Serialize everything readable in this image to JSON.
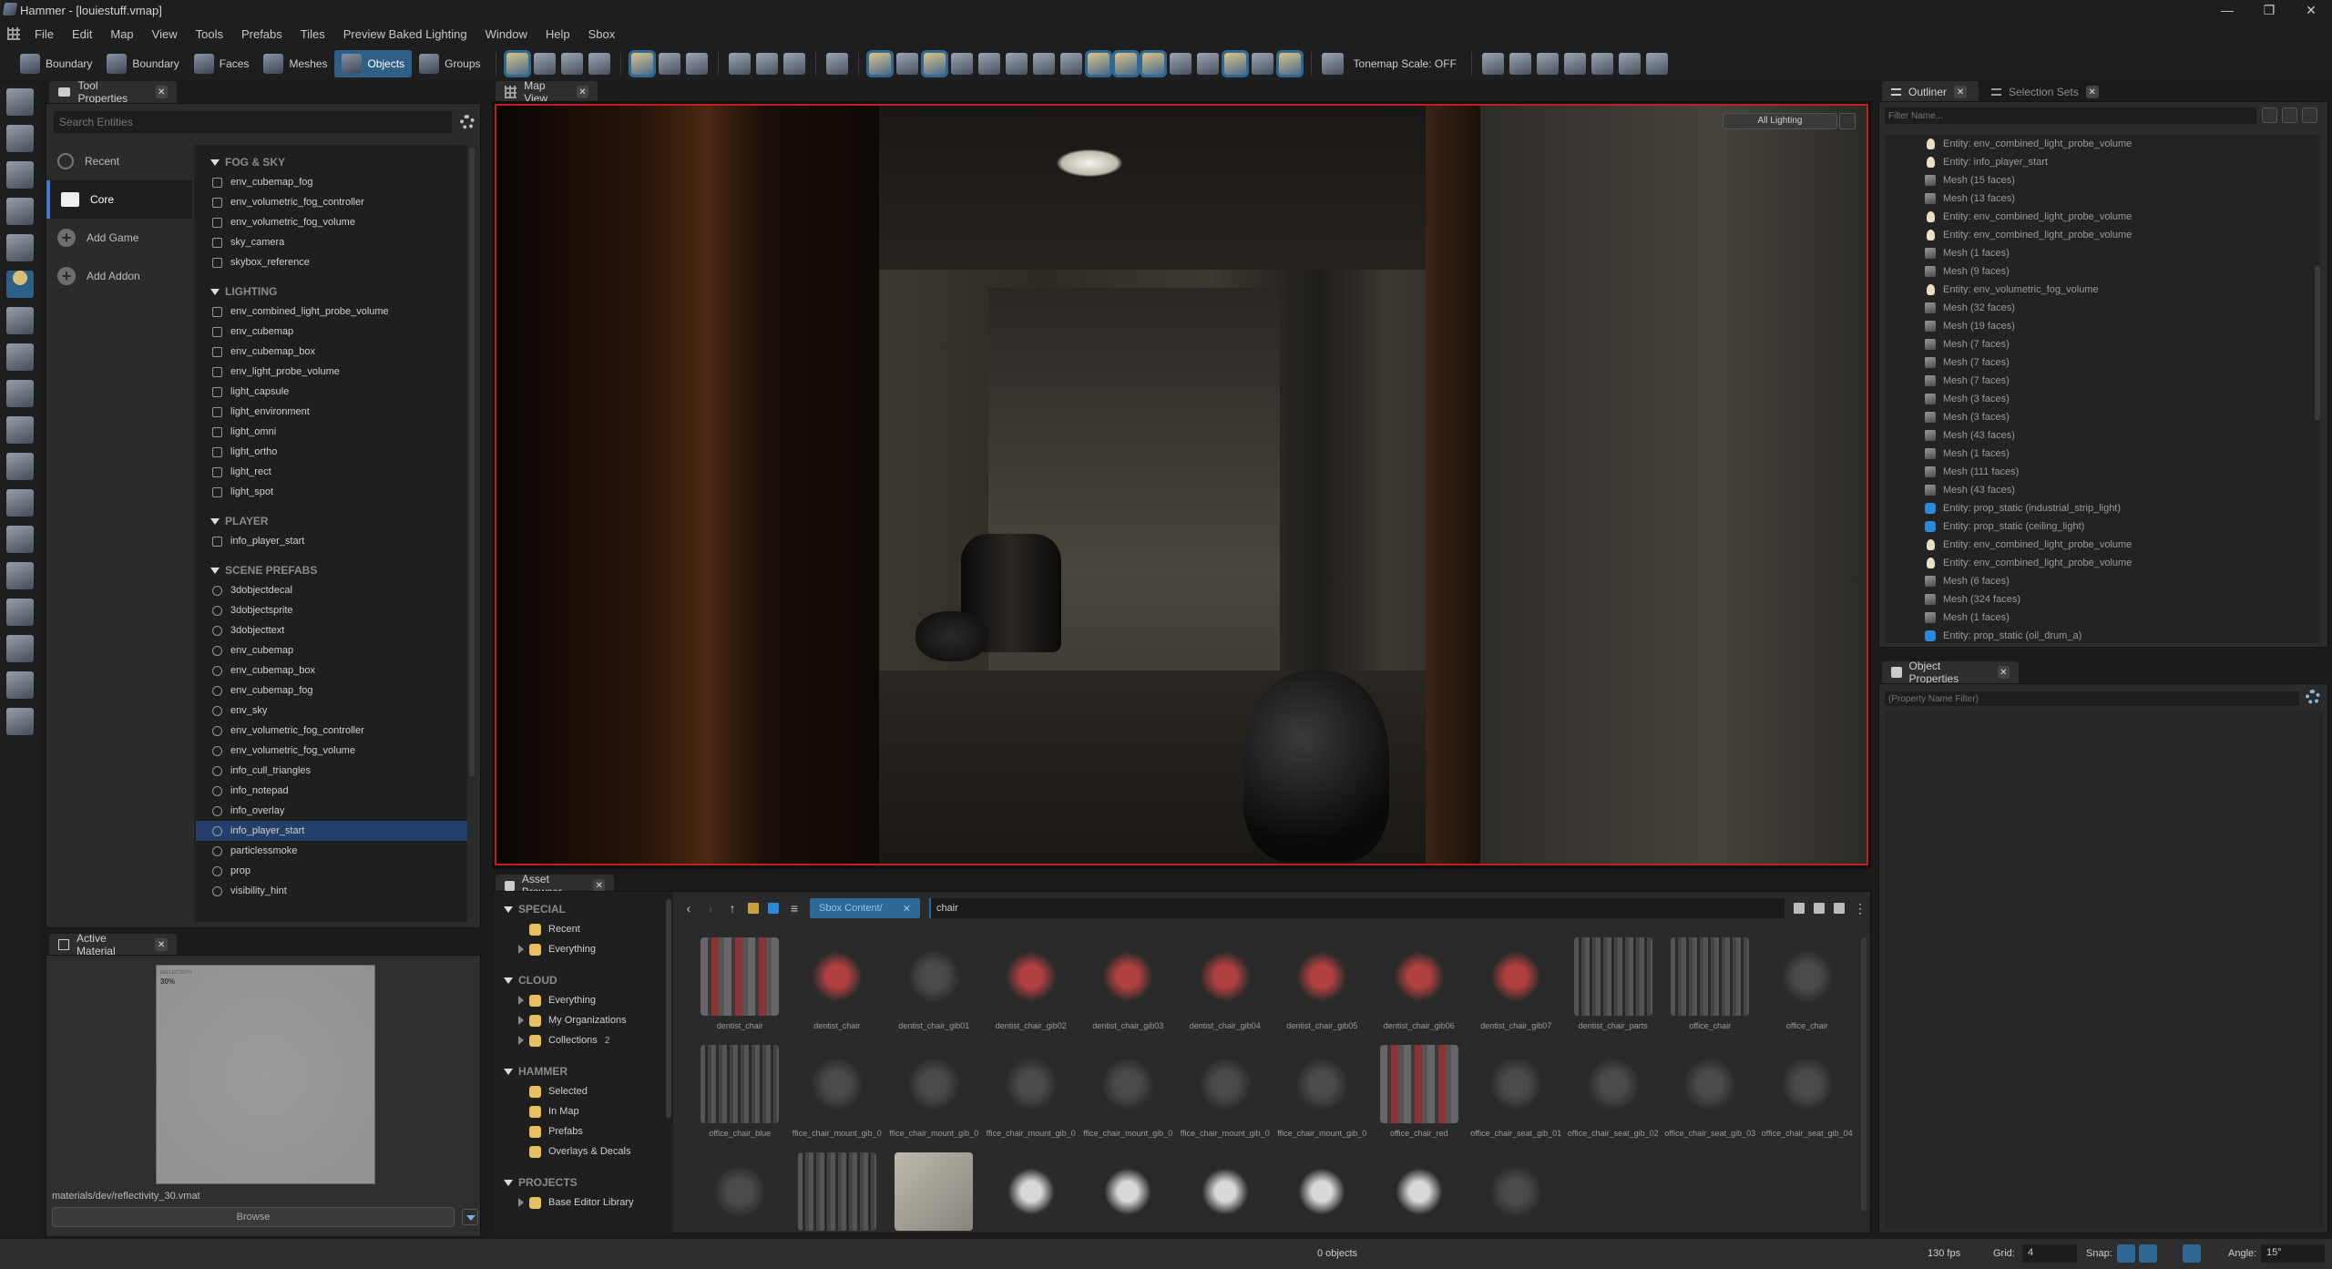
{
  "window": {
    "title": "Hammer - [louiestuff.vmap]",
    "controls": [
      "minimize",
      "restore",
      "close"
    ]
  },
  "menu": [
    "File",
    "Edit",
    "Map",
    "View",
    "Tools",
    "Prefabs",
    "Tiles",
    "Preview Baked Lighting",
    "Window",
    "Help",
    "Sbox"
  ],
  "toolbar": {
    "modes": [
      {
        "label": "Boundary",
        "icon": "boundary-icon",
        "active": false
      },
      {
        "label": "Boundary",
        "icon": "boundary-solid-icon",
        "active": false
      },
      {
        "label": "Faces",
        "icon": "faces-icon",
        "active": false
      },
      {
        "label": "Meshes",
        "icon": "meshes-icon",
        "active": false
      },
      {
        "label": "Objects",
        "icon": "objects-icon",
        "active": true
      },
      {
        "label": "Groups",
        "icon": "groups-icon",
        "active": false
      }
    ],
    "tonemap_label": "Tonemap Scale: OFF"
  },
  "tool_properties": {
    "tab": "Tool Properties",
    "search_placeholder": "Search Entities",
    "categories": [
      {
        "label": "Recent",
        "icon": "history-icon",
        "selected": false
      },
      {
        "label": "Core",
        "icon": "folder-icon",
        "selected": true
      },
      {
        "label": "Add Game",
        "icon": "plus-circle-icon",
        "selected": false
      },
      {
        "label": "Add Addon",
        "icon": "plus-circle-icon",
        "selected": false
      }
    ],
    "sections": [
      {
        "title": "FOG & SKY",
        "items": [
          "env_cubemap_fog",
          "env_volumetric_fog_controller",
          "env_volumetric_fog_volume",
          "sky_camera",
          "skybox_reference"
        ]
      },
      {
        "title": "LIGHTING",
        "items": [
          "env_combined_light_probe_volume",
          "env_cubemap",
          "env_cubemap_box",
          "env_light_probe_volume",
          "light_capsule",
          "light_environment",
          "light_omni",
          "light_ortho",
          "light_rect",
          "light_spot"
        ]
      },
      {
        "title": "PLAYER",
        "items": [
          "info_player_start"
        ]
      },
      {
        "title": "SCENE PREFABS",
        "items": [
          "3dobjectdecal",
          "3dobjectsprite",
          "3dobjecttext",
          "env_cubemap",
          "env_cubemap_box",
          "env_cubemap_fog",
          "env_sky",
          "env_volumetric_fog_controller",
          "env_volumetric_fog_volume",
          "info_cull_triangles",
          "info_notepad",
          "info_overlay",
          "info_player_start",
          "particlessmoke",
          "prop",
          "visibility_hint"
        ]
      }
    ],
    "selected_item": "info_player_start"
  },
  "active_material": {
    "tab": "Active Material",
    "preview_label": "REFLECTIVITY",
    "preview_value": "30%",
    "path": "materials/dev/reflectivity_30.vmat",
    "browse_label": "Browse"
  },
  "map_view": {
    "tab": "Map View",
    "lighting_mode": "All Lighting",
    "border_color": "#c21f1f"
  },
  "asset_browser": {
    "tab": "Asset Browser",
    "tree": [
      {
        "title": "SPECIAL",
        "items": [
          {
            "label": "Recent",
            "expandable": false
          },
          {
            "label": "Everything",
            "expandable": true
          }
        ]
      },
      {
        "title": "CLOUD",
        "items": [
          {
            "label": "Everything",
            "expandable": true
          },
          {
            "label": "My Organizations",
            "expandable": true
          },
          {
            "label": "Collections",
            "expandable": true,
            "count": "2"
          }
        ]
      },
      {
        "title": "HAMMER",
        "items": [
          {
            "label": "Selected",
            "expandable": false
          },
          {
            "label": "In Map",
            "expandable": false
          },
          {
            "label": "Prefabs",
            "expandable": false
          },
          {
            "label": "Overlays & Decals",
            "expandable": false
          }
        ]
      },
      {
        "title": "PROJECTS",
        "items": [
          {
            "label": "Base Editor Library",
            "expandable": true
          }
        ]
      }
    ],
    "path_crumb": "Sbox Content/",
    "search_value": "chair",
    "assets": [
      {
        "name": "dentist_chair",
        "thumb": "tex"
      },
      {
        "name": "dentist_chair",
        "thumb": "red"
      },
      {
        "name": "dentist_chair_gib01",
        "thumb": "grey"
      },
      {
        "name": "dentist_chair_gib02",
        "thumb": "red"
      },
      {
        "name": "dentist_chair_gib03",
        "thumb": "red"
      },
      {
        "name": "dentist_chair_gib04",
        "thumb": "red"
      },
      {
        "name": "dentist_chair_gib05",
        "thumb": "red"
      },
      {
        "name": "dentist_chair_gib06",
        "thumb": "red"
      },
      {
        "name": "dentist_chair_gib07",
        "thumb": "red"
      },
      {
        "name": "dentist_chair_parts",
        "thumb": "texd"
      },
      {
        "name": "office_chair",
        "thumb": "texd"
      },
      {
        "name": "office_chair",
        "thumb": "grey"
      },
      {
        "name": "office_chair_blue",
        "thumb": "texd"
      },
      {
        "name": "ffice_chair_mount_gib_0",
        "thumb": "grey"
      },
      {
        "name": "ffice_chair_mount_gib_0",
        "thumb": "grey"
      },
      {
        "name": "ffice_chair_mount_gib_0",
        "thumb": "grey"
      },
      {
        "name": "ffice_chair_mount_gib_0",
        "thumb": "grey"
      },
      {
        "name": "ffice_chair_mount_gib_0",
        "thumb": "grey"
      },
      {
        "name": "ffice_chair_mount_gib_0",
        "thumb": "grey"
      },
      {
        "name": "office_chair_red",
        "thumb": "tex"
      },
      {
        "name": "office_chair_seat_gib_01",
        "thumb": "grey"
      },
      {
        "name": "office_chair_seat_gib_02",
        "thumb": "grey"
      },
      {
        "name": "office_chair_seat_gib_03",
        "thumb": "grey"
      },
      {
        "name": "office_chair_seat_gib_04",
        "thumb": "grey"
      },
      {
        "name": "",
        "thumb": "grey"
      },
      {
        "name": "",
        "thumb": "texd"
      },
      {
        "name": "",
        "thumb": "concrete"
      },
      {
        "name": "",
        "thumb": "light"
      },
      {
        "name": "",
        "thumb": "light"
      },
      {
        "name": "",
        "thumb": "light"
      },
      {
        "name": "",
        "thumb": "light"
      },
      {
        "name": "",
        "thumb": "light"
      },
      {
        "name": "",
        "thumb": "grey"
      }
    ]
  },
  "outliner": {
    "tabs": [
      "Outliner",
      "Selection Sets"
    ],
    "filter_placeholder": "Filter Name...",
    "rows": [
      {
        "type": "ent",
        "label": "Entity: env_combined_light_probe_volume"
      },
      {
        "type": "ent",
        "label": "Entity: info_player_start"
      },
      {
        "type": "mesh",
        "label": "Mesh (15 faces)"
      },
      {
        "type": "mesh",
        "label": "Mesh (13 faces)"
      },
      {
        "type": "ent",
        "label": "Entity: env_combined_light_probe_volume"
      },
      {
        "type": "ent",
        "label": "Entity: env_combined_light_probe_volume"
      },
      {
        "type": "mesh",
        "label": "Mesh (1 faces)"
      },
      {
        "type": "mesh",
        "label": "Mesh (9 faces)"
      },
      {
        "type": "ent",
        "label": "Entity: env_volumetric_fog_volume"
      },
      {
        "type": "mesh",
        "label": "Mesh (32 faces)"
      },
      {
        "type": "mesh",
        "label": "Mesh (19 faces)"
      },
      {
        "type": "mesh",
        "label": "Mesh (7 faces)"
      },
      {
        "type": "mesh",
        "label": "Mesh (7 faces)"
      },
      {
        "type": "mesh",
        "label": "Mesh (7 faces)"
      },
      {
        "type": "mesh",
        "label": "Mesh (3 faces)"
      },
      {
        "type": "mesh",
        "label": "Mesh (3 faces)"
      },
      {
        "type": "mesh",
        "label": "Mesh (43 faces)"
      },
      {
        "type": "mesh",
        "label": "Mesh (1 faces)"
      },
      {
        "type": "mesh",
        "label": "Mesh (111 faces)"
      },
      {
        "type": "mesh",
        "label": "Mesh (43 faces)"
      },
      {
        "type": "prop",
        "label": "Entity: prop_static (industrial_strip_light)"
      },
      {
        "type": "prop",
        "label": "Entity: prop_static (ceiling_light)"
      },
      {
        "type": "ent",
        "label": "Entity: env_combined_light_probe_volume"
      },
      {
        "type": "ent",
        "label": "Entity: env_combined_light_probe_volume"
      },
      {
        "type": "mesh",
        "label": "Mesh (6 faces)"
      },
      {
        "type": "mesh",
        "label": "Mesh (324 faces)"
      },
      {
        "type": "mesh",
        "label": "Mesh (1 faces)"
      },
      {
        "type": "prop",
        "label": "Entity: prop_static (oil_drum_a)"
      }
    ]
  },
  "object_properties": {
    "tab": "Object Properties",
    "filter_placeholder": "(Property Name Filter)"
  },
  "status": {
    "objects": "0 objects",
    "fps": "130 fps",
    "grid_label": "Grid:",
    "grid_value": "4",
    "snap_label": "Snap:",
    "angle_label": "Angle:",
    "angle_value": "15°"
  },
  "colors": {
    "accent": "#2f6894",
    "selection": "#24406a",
    "viewport_border": "#c21f1f"
  }
}
